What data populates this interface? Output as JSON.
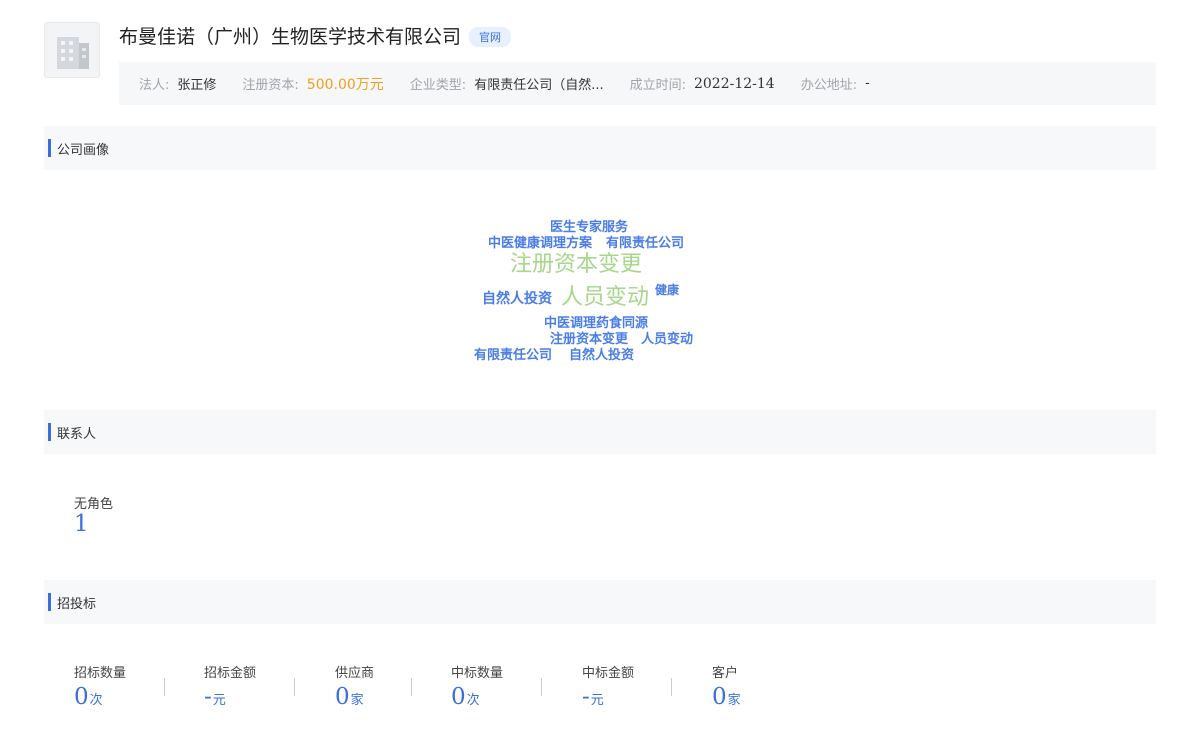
{
  "company": {
    "name": "布曼佳诺（广州）生物医学技术有限公司",
    "site_tag": "官网",
    "logo_icon": "building-icon"
  },
  "info": [
    {
      "label": "法人:",
      "value": "张正修"
    },
    {
      "label": "注册资本:",
      "value": "500.00万元",
      "color": "#f0a020"
    },
    {
      "label": "企业类型:",
      "value": "有限责任公司（自然..."
    },
    {
      "label": "成立时间:",
      "value": "2022-12-14"
    },
    {
      "label": "办公地址:",
      "value": "-"
    }
  ],
  "sections": {
    "portrait": "公司画像",
    "contacts": "联系人",
    "bidding": "招投标"
  },
  "word_cloud": [
    {
      "text": "医生专家服务",
      "color": "#4a7de8"
    },
    {
      "text": "中医健康调理方案",
      "color": "#4a7de8"
    },
    {
      "text": "有限责任公司",
      "color": "#4a7de8"
    },
    {
      "text": "注册资本变更",
      "color": "#a6d78a"
    },
    {
      "text": "自然人投资",
      "color": "#4a7de8"
    },
    {
      "text": "人员变动",
      "color": "#a6d78a"
    },
    {
      "text": "健康",
      "color": "#4a7de8"
    },
    {
      "text": "中医调理药食同源",
      "color": "#4a7de8"
    },
    {
      "text": "注册资本变更",
      "color": "#4a7de8"
    },
    {
      "text": "人员变动",
      "color": "#4a7de8"
    },
    {
      "text": "有限责任公司",
      "color": "#4a7de8"
    },
    {
      "text": "自然人投资",
      "color": "#4a7de8"
    }
  ],
  "contacts": {
    "label": "无角色",
    "value": "1"
  },
  "bidding_stats": [
    {
      "label": "招标数量",
      "value": "0",
      "unit": "次"
    },
    {
      "label": "招标金额",
      "value": "-",
      "unit": "元"
    },
    {
      "label": "供应商",
      "value": "0",
      "unit": "家"
    },
    {
      "label": "中标数量",
      "value": "0",
      "unit": "次"
    },
    {
      "label": "中标金额",
      "value": "-",
      "unit": "元"
    },
    {
      "label": "客户",
      "value": "0",
      "unit": "家"
    }
  ],
  "colors": {
    "accent": "#3a6fd8",
    "highlight": "#f0a020",
    "cloud_green": "#a6d78a"
  }
}
